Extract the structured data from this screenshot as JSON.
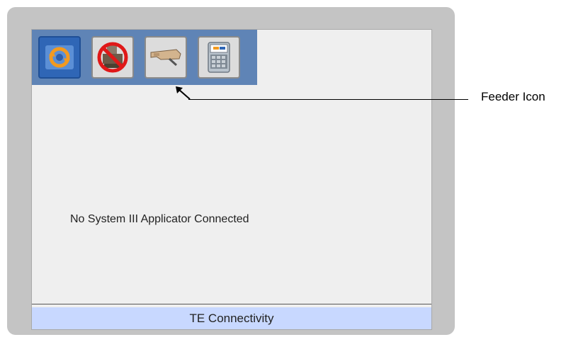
{
  "toolbar": {
    "buttons": [
      {
        "icon": "refresh-icon",
        "state": "active"
      },
      {
        "icon": "no-applicator-icon",
        "state": "normal"
      },
      {
        "icon": "feeder-icon",
        "state": "normal"
      },
      {
        "icon": "te-device-icon",
        "state": "normal"
      }
    ]
  },
  "main": {
    "message": "No System III Applicator Connected"
  },
  "status_bar": {
    "text": "TE Connectivity"
  },
  "callout": {
    "label": "Feeder Icon"
  },
  "colors": {
    "toolbar_bg": "#5f84b6",
    "active_button": "#2f66b6",
    "status_bar_bg": "#c8d8ff",
    "bezel": "#c4c4c4"
  }
}
